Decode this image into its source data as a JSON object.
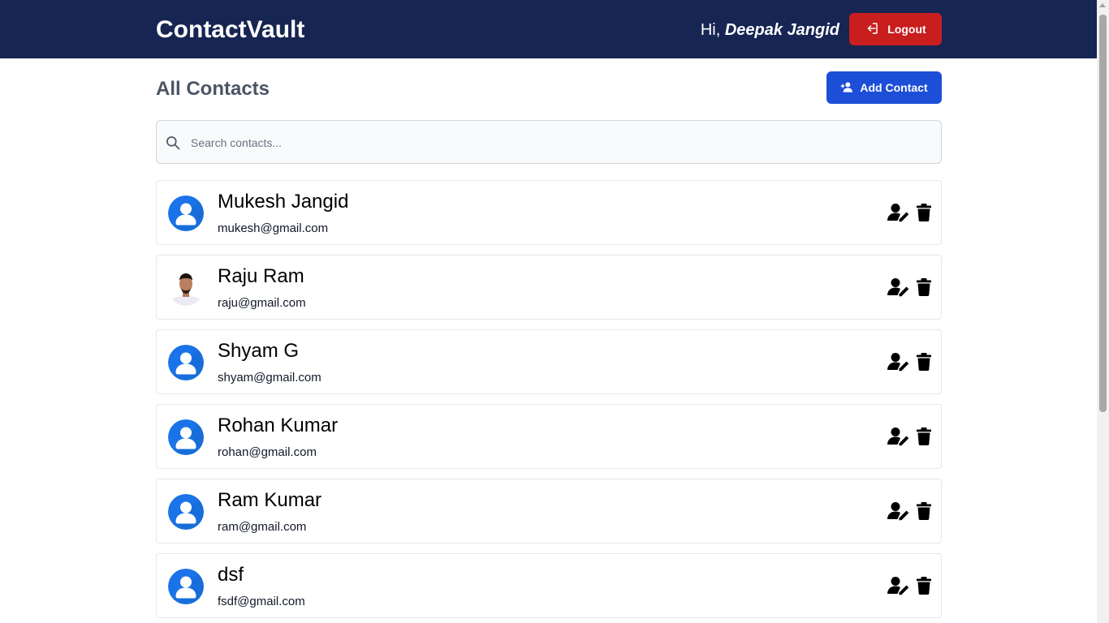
{
  "header": {
    "brand": "ContactVault",
    "greeting_prefix": "Hi,",
    "user_name": "Deepak Jangid",
    "logout_label": "Logout"
  },
  "main": {
    "title": "All Contacts",
    "add_button_label": "Add Contact",
    "search": {
      "placeholder": "Search contacts...",
      "value": ""
    }
  },
  "contacts": [
    {
      "name": "Mukesh Jangid",
      "email": "mukesh@gmail.com",
      "avatar": "default-user-icon"
    },
    {
      "name": "Raju Ram",
      "email": "raju@gmail.com",
      "avatar": "photo"
    },
    {
      "name": "Shyam G",
      "email": "shyam@gmail.com",
      "avatar": "default-user-icon"
    },
    {
      "name": "Rohan Kumar",
      "email": "rohan@gmail.com",
      "avatar": "default-user-icon"
    },
    {
      "name": "Ram Kumar",
      "email": "ram@gmail.com",
      "avatar": "default-user-icon"
    },
    {
      "name": "dsf",
      "email": "fsdf@gmail.com",
      "avatar": "default-user-icon"
    }
  ],
  "icons": {
    "logout": "logout-icon",
    "add": "add-user-icon",
    "search": "search-icon",
    "edit": "edit-user-icon",
    "delete": "trash-icon"
  },
  "colors": {
    "header_bg": "#172553",
    "logout_bg": "#c81e1e",
    "primary": "#1d4ed8",
    "title_text": "#4b5563"
  }
}
